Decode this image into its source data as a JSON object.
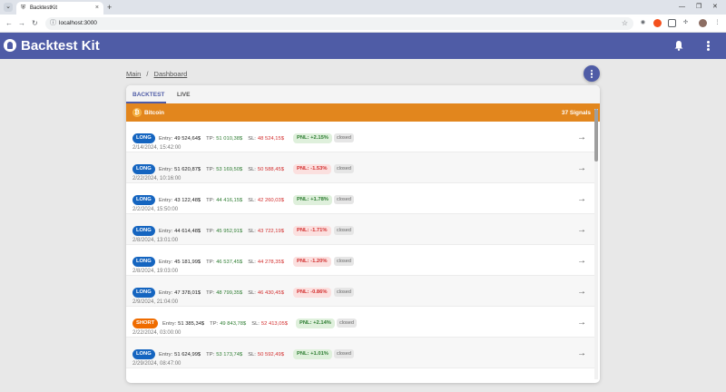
{
  "browser": {
    "tab_title": "BacktestKit",
    "tab_close": "×",
    "new_tab": "+",
    "url": "localhost:3000",
    "win_minimize": "—",
    "win_restore": "❐",
    "win_close": "✕"
  },
  "app": {
    "title": "Backtest Kit",
    "accent": "#4f5ca6"
  },
  "breadcrumb": {
    "items": [
      "Main",
      "Dashboard"
    ],
    "separator": "/"
  },
  "tabs": {
    "items": [
      "BACKTEST",
      "LIVE"
    ],
    "active": "BACKTEST"
  },
  "asset": {
    "name": "Bitcoin",
    "signals": "37 Signals",
    "color": "#e2861d"
  },
  "labels": {
    "entry": "Entry:",
    "tp": "TP:",
    "sl": "SL:"
  },
  "signals": [
    {
      "side": "LONG",
      "entry": "49 524,64$",
      "tp": "51 010,38$",
      "sl": "48 524,15$",
      "pnl": "PNL: +2.15%",
      "pnl_sign": "pos",
      "status": "closed",
      "date": "2/14/2024, 15:42:00"
    },
    {
      "side": "LONG",
      "entry": "51 620,87$",
      "tp": "53 169,50$",
      "sl": "50 588,45$",
      "pnl": "PNL: -1.53%",
      "pnl_sign": "neg",
      "status": "closed",
      "date": "2/22/2024, 10:16:00"
    },
    {
      "side": "LONG",
      "entry": "43 122,48$",
      "tp": "44 416,15$",
      "sl": "42 260,03$",
      "pnl": "PNL: +1.78%",
      "pnl_sign": "pos",
      "status": "closed",
      "date": "2/2/2024, 15:50:00"
    },
    {
      "side": "LONG",
      "entry": "44 614,48$",
      "tp": "45 952,91$",
      "sl": "43 722,19$",
      "pnl": "PNL: -1.71%",
      "pnl_sign": "neg",
      "status": "closed",
      "date": "2/8/2024, 13:01:00"
    },
    {
      "side": "LONG",
      "entry": "45 181,99$",
      "tp": "46 537,45$",
      "sl": "44 278,35$",
      "pnl": "PNL: -1.20%",
      "pnl_sign": "neg",
      "status": "closed",
      "date": "2/8/2024, 19:03:00"
    },
    {
      "side": "LONG",
      "entry": "47 378,01$",
      "tp": "48 799,35$",
      "sl": "46 430,45$",
      "pnl": "PNL: -0.86%",
      "pnl_sign": "neg",
      "status": "closed",
      "date": "2/9/2024, 21:04:00"
    },
    {
      "side": "SHORT",
      "entry": "51 385,34$",
      "tp": "49 843,78$",
      "sl": "52 413,05$",
      "pnl": "PNL: +2.14%",
      "pnl_sign": "pos",
      "status": "closed",
      "date": "2/22/2024, 03:00:00"
    },
    {
      "side": "LONG",
      "entry": "51 624,99$",
      "tp": "53 173,74$",
      "sl": "50 592,49$",
      "pnl": "PNL: +1.01%",
      "pnl_sign": "pos",
      "status": "closed",
      "date": "2/29/2024, 08:47:00"
    }
  ]
}
